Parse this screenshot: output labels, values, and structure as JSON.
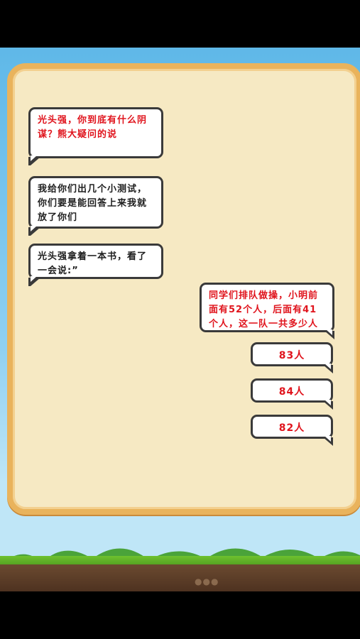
{
  "dialogue": [
    {
      "speaker": "narration",
      "text": "光头强，你到底有什么阴谋？熊大疑问的说"
    },
    {
      "speaker": "npc",
      "text": "我给你们出几个小测试，你们要是能回答上来我就放了你们"
    },
    {
      "speaker": "npc",
      "text": "光头强拿着一本书，看了一会说:”"
    }
  ],
  "question": "同学们排队做操，小明前面有52个人，后面有41个人，这一队一共多少人",
  "options": [
    "83人",
    "84人",
    "82人"
  ],
  "colors": {
    "red_text": "#e0141d",
    "board": "#f6e9c3",
    "frame": "#e9b35c"
  }
}
